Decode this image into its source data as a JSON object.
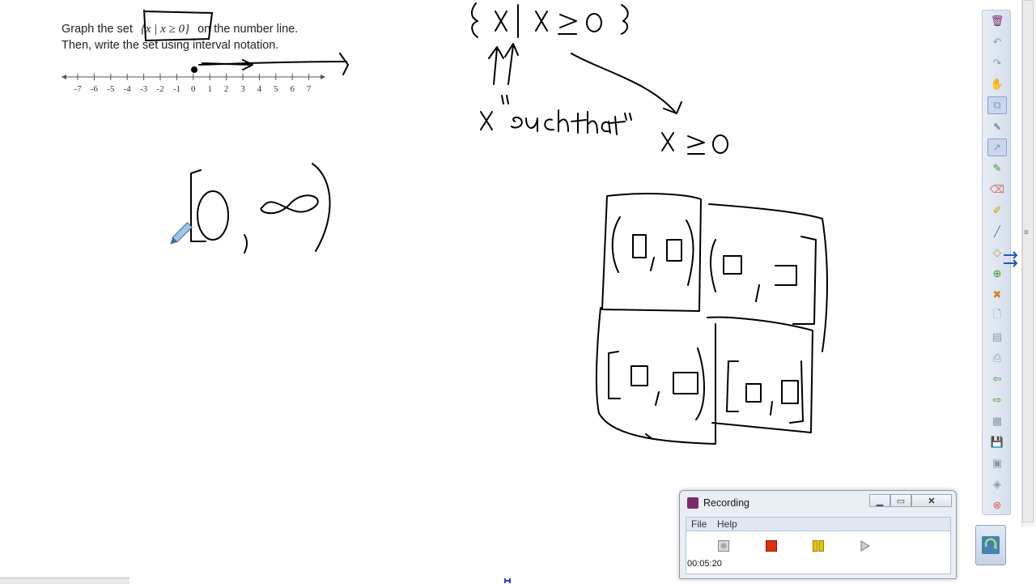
{
  "problem": {
    "line1_before": "Graph the set",
    "set_notation": "{x | x ≥ 0}",
    "line1_after": "on the number line.",
    "line2": "Then, write the set using interval notation."
  },
  "number_line": {
    "ticks": [
      "-7",
      "-6",
      "-5",
      "-4",
      "-3",
      "-2",
      "-1",
      "0",
      "1",
      "2",
      "3",
      "4",
      "5",
      "6",
      "7"
    ]
  },
  "handwriting": {
    "set_builder": "{ x | x ≥ 0 }",
    "such_that_label": "x \"such that\"",
    "condition": "x ≥ 0"
  },
  "toolbar": {
    "tools": [
      "trash-icon",
      "undo-icon",
      "redo-icon",
      "hand-icon",
      "copy-icon",
      "select-icon",
      "pointer-icon",
      "pen-icon",
      "eraser-icon",
      "highlighter-icon",
      "line-icon",
      "shape-icon",
      "insert-icon",
      "delete-icon",
      "new-page-icon",
      "page-icon",
      "screen-capture-icon",
      "prev-page-icon",
      "next-page-icon",
      "table-icon",
      "save-icon",
      "image-icon",
      "clear-icon",
      "close-icon"
    ]
  },
  "recording": {
    "title": "Recording",
    "menu": [
      "File",
      "Help"
    ],
    "time": "00:05:20",
    "colors": {
      "stop": "#e03010",
      "pause": "#e6c400"
    }
  }
}
